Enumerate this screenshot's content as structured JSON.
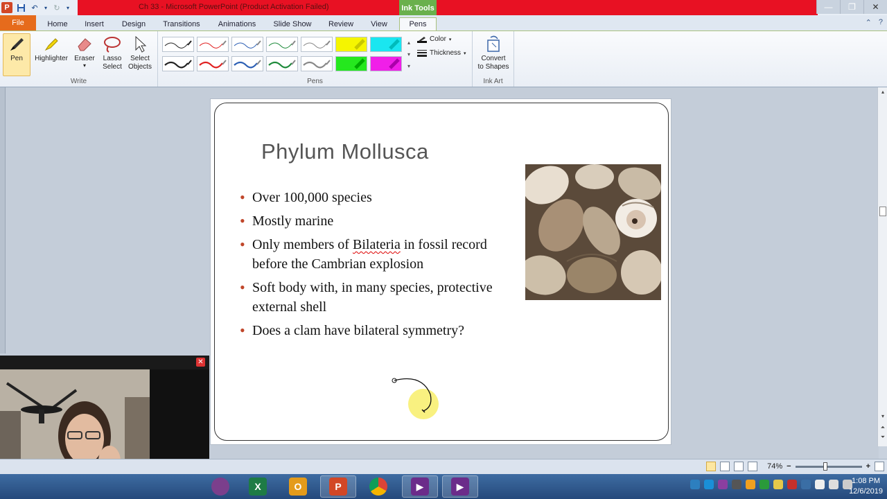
{
  "window": {
    "title": "Ch 33 - Microsoft PowerPoint (Product Activation Failed)",
    "context_tab": "Ink Tools",
    "controls": {
      "minimize": "—",
      "restore": "❐",
      "close": "✕"
    }
  },
  "ribbon_tabs": [
    "File",
    "Home",
    "Insert",
    "Design",
    "Transitions",
    "Animations",
    "Slide Show",
    "Review",
    "View",
    "Pens"
  ],
  "active_tab": "Pens",
  "ribbon": {
    "write": {
      "label": "Write",
      "tools": [
        {
          "label": "Pen",
          "icon": "pen-icon"
        },
        {
          "label": "Highlighter",
          "icon": "highlighter-icon"
        },
        {
          "label": "Eraser",
          "icon": "eraser-icon"
        },
        {
          "label": "Lasso\nSelect",
          "icon": "lasso-icon"
        },
        {
          "label": "Select\nObjects",
          "icon": "cursor-arrow-icon"
        }
      ]
    },
    "pens": {
      "label": "Pens",
      "color_label": "Color",
      "thickness_label": "Thickness"
    },
    "ink_art": {
      "label": "Ink Art",
      "convert_label": "Convert\nto Shapes"
    }
  },
  "colors": {
    "pen_black": "#222222",
    "pen_red": "#e02020",
    "pen_blue": "#2c5fb4",
    "pen_green": "#1d8a3a",
    "pen_gray": "#888888",
    "highlight_yellow": "#f5f500",
    "highlight_cyan": "#1ae6f0",
    "highlight_green": "#25e81e",
    "highlight_magenta": "#f01fe8",
    "bullet_accent": "#c0462a",
    "title_bar_red": "#e81123",
    "file_tab": "#e66b1c",
    "ink_tools_green": "#6ab04c"
  },
  "slide": {
    "title": "Phylum Mollusca",
    "bullets": [
      {
        "parts": [
          "Over 100,000 species"
        ]
      },
      {
        "parts": [
          "Mostly marine"
        ]
      },
      {
        "parts": [
          "Only members of ",
          "Bilateria",
          " in fossil record before the  Cambrian explosion"
        ],
        "spell_flag_index": 1
      },
      {
        "parts": [
          "Soft body with, in many species, protective external shell"
        ]
      },
      {
        "parts": [
          "Does a clam have bilateral symmetry?"
        ]
      }
    ],
    "image": "clam-shells-photo"
  },
  "webcam": {
    "close": "✕",
    "content": "presenter-webcam-feed"
  },
  "statusbar": {
    "zoom": "74%",
    "zoom_out": "−",
    "zoom_in": "+"
  },
  "taskbar": {
    "apps": [
      "orb-icon",
      "excel-icon",
      "outlook-icon",
      "powerpoint-icon",
      "chrome-icon",
      "video-app-icon",
      "video-app-2-icon"
    ],
    "time": "1:08 PM",
    "date": "12/6/2019"
  }
}
